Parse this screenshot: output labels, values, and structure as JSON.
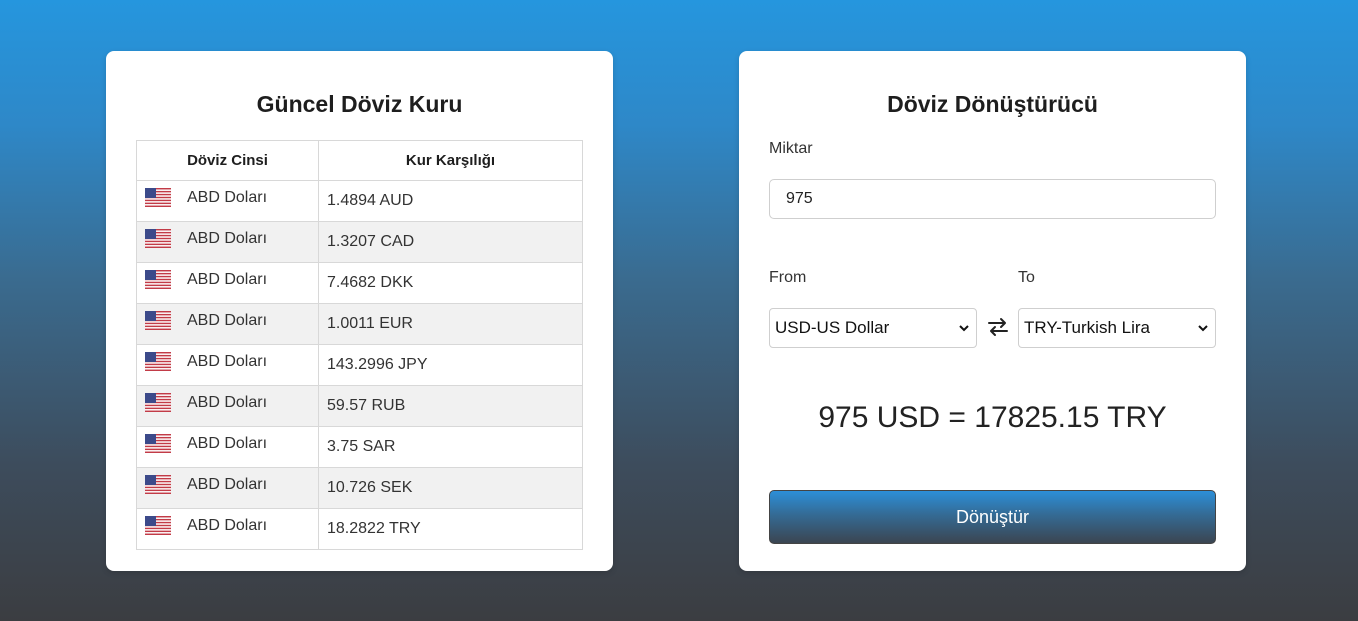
{
  "rates_card": {
    "title": "Güncel Döviz Kuru",
    "columns": [
      "Döviz Cinsi",
      "Kur Karşılığı"
    ],
    "rows": [
      {
        "currency": "ABD Doları",
        "flag_icon": "us-flag-icon",
        "value": "1.4894 AUD"
      },
      {
        "currency": "ABD Doları",
        "flag_icon": "us-flag-icon",
        "value": "1.3207 CAD"
      },
      {
        "currency": "ABD Doları",
        "flag_icon": "us-flag-icon",
        "value": "7.4682 DKK"
      },
      {
        "currency": "ABD Doları",
        "flag_icon": "us-flag-icon",
        "value": "1.0011 EUR"
      },
      {
        "currency": "ABD Doları",
        "flag_icon": "us-flag-icon",
        "value": "143.2996 JPY"
      },
      {
        "currency": "ABD Doları",
        "flag_icon": "us-flag-icon",
        "value": "59.57 RUB"
      },
      {
        "currency": "ABD Doları",
        "flag_icon": "us-flag-icon",
        "value": "3.75 SAR"
      },
      {
        "currency": "ABD Doları",
        "flag_icon": "us-flag-icon",
        "value": "10.726 SEK"
      },
      {
        "currency": "ABD Doları",
        "flag_icon": "us-flag-icon",
        "value": "18.2822 TRY"
      }
    ]
  },
  "converter_card": {
    "title": "Döviz Dönüştürücü",
    "amount_label": "Miktar",
    "amount_value": "975",
    "from_label": "From",
    "to_label": "To",
    "from_selected": "USD-US Dollar",
    "to_selected": "TRY-Turkish Lira",
    "swap_icon": "swap-arrows-icon",
    "result": "975 USD = 17825.15 TRY",
    "convert_button": "Dönüştür"
  },
  "colors": {
    "background_top": "#2596de",
    "background_bottom": "#3b3d41",
    "button_top": "#2c8fd8",
    "button_bottom": "#3b4551"
  }
}
